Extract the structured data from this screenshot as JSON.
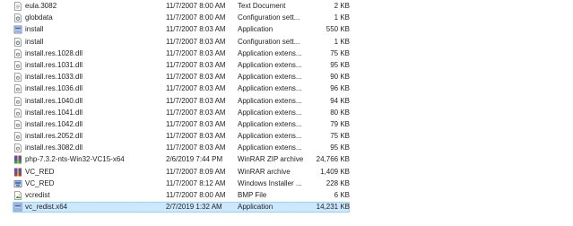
{
  "files": [
    {
      "name": "eula.3082",
      "date": "11/7/2007 8:00 AM",
      "type": "Text Document",
      "size": "2 KB",
      "icon": "text-file-icon"
    },
    {
      "name": "globdata",
      "date": "11/7/2007 8:00 AM",
      "type": "Configuration sett...",
      "size": "1 KB",
      "icon": "config-file-icon"
    },
    {
      "name": "install",
      "date": "11/7/2007 8:03 AM",
      "type": "Application",
      "size": "550 KB",
      "icon": "installer-app-icon"
    },
    {
      "name": "install",
      "date": "11/7/2007 8:03 AM",
      "type": "Configuration sett...",
      "size": "1 KB",
      "icon": "config-file-icon"
    },
    {
      "name": "install.res.1028.dll",
      "date": "11/7/2007 8:03 AM",
      "type": "Application extens...",
      "size": "75 KB",
      "icon": "dll-file-icon"
    },
    {
      "name": "install.res.1031.dll",
      "date": "11/7/2007 8:03 AM",
      "type": "Application extens...",
      "size": "95 KB",
      "icon": "dll-file-icon"
    },
    {
      "name": "install.res.1033.dll",
      "date": "11/7/2007 8:03 AM",
      "type": "Application extens...",
      "size": "90 KB",
      "icon": "dll-file-icon"
    },
    {
      "name": "install.res.1036.dll",
      "date": "11/7/2007 8:03 AM",
      "type": "Application extens...",
      "size": "96 KB",
      "icon": "dll-file-icon"
    },
    {
      "name": "install.res.1040.dll",
      "date": "11/7/2007 8:03 AM",
      "type": "Application extens...",
      "size": "94 KB",
      "icon": "dll-file-icon"
    },
    {
      "name": "install.res.1041.dll",
      "date": "11/7/2007 8:03 AM",
      "type": "Application extens...",
      "size": "80 KB",
      "icon": "dll-file-icon"
    },
    {
      "name": "install.res.1042.dll",
      "date": "11/7/2007 8:03 AM",
      "type": "Application extens...",
      "size": "79 KB",
      "icon": "dll-file-icon"
    },
    {
      "name": "install.res.2052.dll",
      "date": "11/7/2007 8:03 AM",
      "type": "Application extens...",
      "size": "75 KB",
      "icon": "dll-file-icon"
    },
    {
      "name": "install.res.3082.dll",
      "date": "11/7/2007 8:03 AM",
      "type": "Application extens...",
      "size": "95 KB",
      "icon": "dll-file-icon"
    },
    {
      "name": "php-7.3.2-nts-Win32-VC15-x64",
      "date": "2/6/2019 7:44 PM",
      "type": "WinRAR ZIP archive",
      "size": "24,766 KB",
      "icon": "winrar-zip-icon"
    },
    {
      "name": "VC_RED",
      "date": "11/7/2007 8:09 AM",
      "type": "WinRAR archive",
      "size": "1,409 KB",
      "icon": "winrar-archive-icon"
    },
    {
      "name": "VC_RED",
      "date": "11/7/2007 8:12 AM",
      "type": "Windows Installer ...",
      "size": "228 KB",
      "icon": "msi-installer-icon"
    },
    {
      "name": "vcredist",
      "date": "11/7/2007 8:00 AM",
      "type": "BMP File",
      "size": "6 KB",
      "icon": "bmp-image-icon"
    },
    {
      "name": "vc_redist.x64",
      "date": "2/7/2019 1:32 AM",
      "type": "Application",
      "size": "14,231 KB",
      "icon": "installer-app-icon",
      "selected": true
    }
  ],
  "colors": {
    "selection_bg": "#cce8ff",
    "selection_border": "#99d1ff",
    "text": "#1f1f1f"
  }
}
